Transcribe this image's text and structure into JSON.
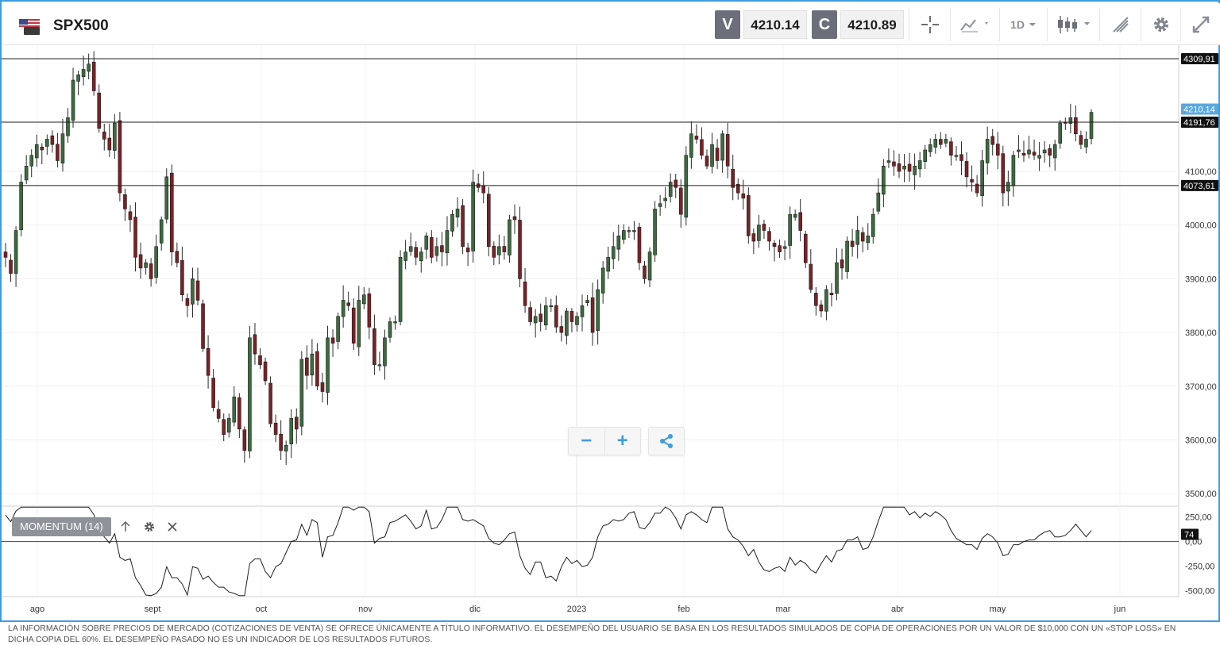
{
  "header": {
    "symbol": "SPX500",
    "flag_icon": "us-flag-icon",
    "sell_label": "V",
    "sell_price": "4210.14",
    "buy_label": "C",
    "buy_price": "4210.89",
    "timeframe": "1D",
    "tools": [
      "crosshair-icon",
      "line-chart-type-icon",
      "timeframe-selector",
      "candlestick-type-icon",
      "drawing-tools-icon",
      "gear-icon",
      "fullscreen-icon"
    ]
  },
  "chart_data": {
    "type": "candlestick",
    "symbol": "SPX500",
    "price_axis_ticks": [
      "3500,00",
      "3600,00",
      "3700,00",
      "3800,00",
      "3900,00",
      "4000,00",
      "4100,00"
    ],
    "price_range": [
      3478,
      4335
    ],
    "horizontal_lines": [
      {
        "value": 4309.91,
        "label": "4309,91"
      },
      {
        "value": 4191.76,
        "label": "4191,76"
      },
      {
        "value": 4073.61,
        "label": "4073,61"
      }
    ],
    "current_price": {
      "value": 4210.14,
      "label": "4210,14"
    },
    "time_axis_labels": [
      "ago",
      "sept",
      "oct",
      "nov",
      "dic",
      "2023",
      "feb",
      "mar",
      "abr",
      "may",
      "jun"
    ],
    "closes": [
      3940,
      3910,
      3990,
      4080,
      4110,
      4130,
      4150,
      4140,
      4160,
      4150,
      4120,
      4170,
      4200,
      4270,
      4280,
      4290,
      4300,
      4250,
      4180,
      4160,
      4140,
      4190,
      4060,
      4030,
      4010,
      3940,
      3920,
      3930,
      3900,
      3960,
      4010,
      4090,
      3950,
      3930,
      3870,
      3850,
      3900,
      3860,
      3770,
      3720,
      3660,
      3640,
      3610,
      3640,
      3680,
      3620,
      3580,
      3790,
      3760,
      3740,
      3710,
      3630,
      3610,
      3580,
      3590,
      3640,
      3620,
      3750,
      3720,
      3760,
      3700,
      3690,
      3790,
      3780,
      3830,
      3860,
      3850,
      3780,
      3860,
      3870,
      3810,
      3740,
      3740,
      3790,
      3820,
      3820,
      3940,
      3950,
      3960,
      3940,
      3950,
      3980,
      3940,
      3960,
      3950,
      3990,
      4020,
      4030,
      3960,
      3950,
      4080,
      4070,
      4060,
      3960,
      3940,
      3960,
      3950,
      4010,
      4010,
      3900,
      3850,
      3820,
      3830,
      3820,
      3850,
      3850,
      3810,
      3800,
      3840,
      3820,
      3830,
      3850,
      3860,
      3800,
      3880,
      3920,
      3940,
      3960,
      3980,
      3990,
      3990,
      3990,
      3930,
      3900,
      3950,
      4030,
      4040,
      4050,
      4080,
      4070,
      4020,
      4130,
      4170,
      4160,
      4130,
      4110,
      4150,
      4120,
      4170,
      4110,
      4070,
      4060,
      4050,
      3980,
      3970,
      4000,
      3990,
      3970,
      3960,
      3950,
      3960,
      4020,
      4020,
      3990,
      3930,
      3880,
      3850,
      3840,
      3880,
      3870,
      3930,
      3920,
      3970,
      3960,
      3990,
      3970,
      3980,
      4020,
      4060,
      4110,
      4120,
      4110,
      4100,
      4110,
      4100,
      4110,
      4120,
      4140,
      4150,
      4160,
      4150,
      4160,
      4130,
      4130,
      4120,
      4090,
      4080,
      4060,
      4120,
      4160,
      4150,
      4130,
      4060,
      4080,
      4130,
      4140,
      4130,
      4140,
      4130,
      4130,
      4140,
      4130,
      4150,
      4190,
      4190,
      4200,
      4170,
      4150,
      4160,
      4210
    ],
    "indicator": {
      "name": "MOMENTUM (14)",
      "axis_ticks": [
        "250,00",
        "0,00",
        "-250,00",
        "-500,00"
      ],
      "range": [
        -560,
        360
      ],
      "current_value": 74,
      "current_label": "74"
    }
  },
  "zoom_controls": {
    "zoom_out": "−",
    "zoom_in": "+"
  },
  "disclaimer": "LA INFORMACIÓN SOBRE PRECIOS DE MERCADO (COTIZACIONES DE VENTA) SE OFRECE ÚNICAMENTE A TÍTULO INFORMATIVO. EL DESEMPEÑO DEL USUARIO SE BASA EN LOS RESULTADOS SIMULADOS DE COPIA DE OPERACIONES POR UN VALOR DE $10,000 CON UN «STOP LOSS» EN DICHA COPIA DEL 60%. EL DESEMPEÑO PASADO NO ES UN INDICADOR DE LOS RESULTADOS FUTUROS."
}
